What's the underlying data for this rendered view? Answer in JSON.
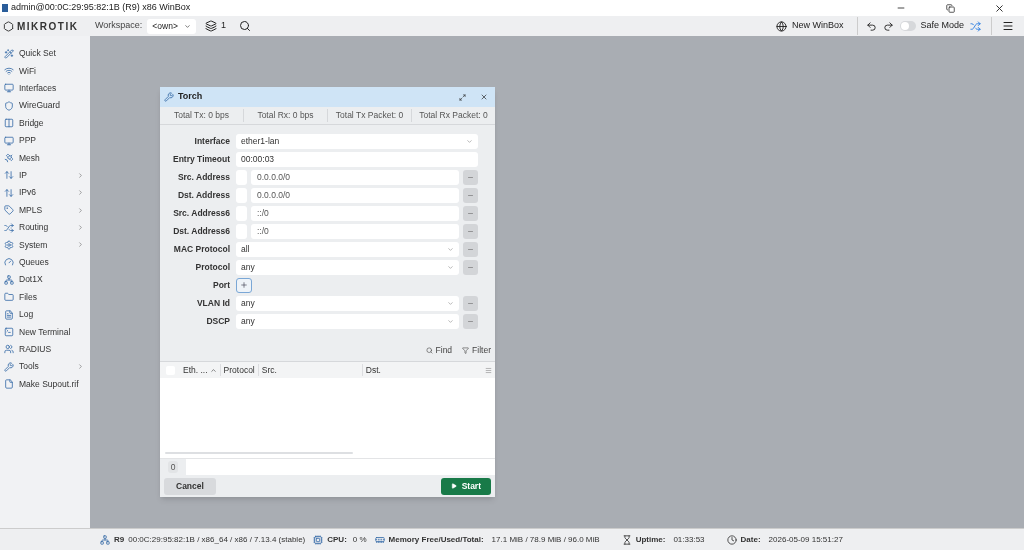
{
  "title_bar": {
    "title": "admin@00:0C:29:95:82:1B (R9) x86 WinBox"
  },
  "toolbar": {
    "logo": "MIKROTIK",
    "workspace_label": "Workspace:",
    "workspace_value": "<own>",
    "window_count": "1",
    "new_winbox": "New WinBox",
    "safe_mode": {
      "label": "Safe Mode",
      "on": false
    }
  },
  "sidebar": {
    "items": [
      {
        "label": "Quick Set",
        "submenu": false
      },
      {
        "label": "WiFi",
        "submenu": false
      },
      {
        "label": "Interfaces",
        "submenu": false
      },
      {
        "label": "WireGuard",
        "submenu": false
      },
      {
        "label": "Bridge",
        "submenu": false
      },
      {
        "label": "PPP",
        "submenu": false
      },
      {
        "label": "Mesh",
        "submenu": false
      },
      {
        "label": "IP",
        "submenu": true
      },
      {
        "label": "IPv6",
        "submenu": true
      },
      {
        "label": "MPLS",
        "submenu": true
      },
      {
        "label": "Routing",
        "submenu": true
      },
      {
        "label": "System",
        "submenu": true
      },
      {
        "label": "Queues",
        "submenu": false
      },
      {
        "label": "Dot1X",
        "submenu": false
      },
      {
        "label": "Files",
        "submenu": false
      },
      {
        "label": "Log",
        "submenu": false
      },
      {
        "label": "New Terminal",
        "submenu": false
      },
      {
        "label": "RADIUS",
        "submenu": false
      },
      {
        "label": "Tools",
        "submenu": true
      },
      {
        "label": "Make Supout.rif",
        "submenu": false
      }
    ]
  },
  "torch_window": {
    "title": "Torch",
    "stats": [
      "Total Tx: 0 bps",
      "Total Rx: 0 bps",
      "Total Tx Packet: 0",
      "Total Rx Packet: 0"
    ],
    "fields": [
      {
        "label": "Interface",
        "kind": "select",
        "value": "ether1-lan",
        "removable": false
      },
      {
        "label": "Entry Timeout",
        "kind": "text",
        "value": "00:00:03",
        "removable": false
      },
      {
        "label": "Src. Address",
        "kind": "address",
        "value": "0.0.0.0/0",
        "removable": true
      },
      {
        "label": "Dst. Address",
        "kind": "address",
        "value": "0.0.0.0/0",
        "removable": true
      },
      {
        "label": "Src. Address6",
        "kind": "address",
        "value": "::/0",
        "removable": true
      },
      {
        "label": "Dst. Address6",
        "kind": "address",
        "value": "::/0",
        "removable": true
      },
      {
        "label": "MAC Protocol",
        "kind": "select",
        "value": "all",
        "removable": true
      },
      {
        "label": "Protocol",
        "kind": "select",
        "value": "any",
        "removable": true
      },
      {
        "label": "Port",
        "kind": "add",
        "removable": false
      },
      {
        "label": "VLAN Id",
        "kind": "select",
        "value": "any",
        "removable": true
      },
      {
        "label": "DSCP",
        "kind": "select",
        "value": "any",
        "removable": true
      }
    ],
    "find": "Find",
    "filter": "Filter",
    "table": {
      "select_all_checked": false,
      "columns": [
        {
          "label": "Eth. ...",
          "sorted": true
        },
        {
          "label": "Protocol",
          "sorted": false
        },
        {
          "label": "Src.",
          "sorted": false
        },
        {
          "label": "Dst.",
          "sorted": false
        }
      ]
    },
    "count": "0",
    "cancel": "Cancel",
    "start": "Start"
  },
  "status_bar": {
    "device_name": "R9",
    "device_info": "00:0C:29:95:82:1B / x86_64 / x86 / 7.13.4 (stable)",
    "cpu_label": "CPU:",
    "cpu": "0 %",
    "memory_label": "Memory Free/Used/Total:",
    "memory": "17.1 MiB / 78.9 MiB / 96.0 MiB",
    "uptime_label": "Uptime:",
    "uptime": "01:33:53",
    "date_label": "Date:",
    "date": "2026-05-09 15:51:27"
  }
}
